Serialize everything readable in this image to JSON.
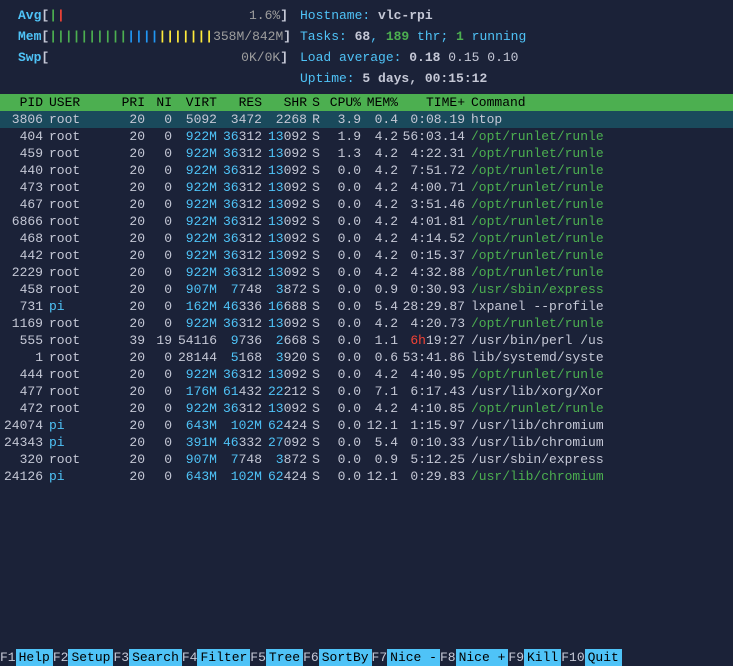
{
  "meters": {
    "avg": {
      "label": "Avg",
      "bars": "||",
      "value": "1.6%"
    },
    "mem": {
      "label": "Mem",
      "bars": "|||||||||||||||||||||",
      "value": "358M/842M"
    },
    "swp": {
      "label": "Swp",
      "bars": "",
      "value": "0K/0K"
    }
  },
  "info": {
    "hostname_label": "Hostname: ",
    "hostname": "vlc-rpi",
    "tasks_label": "Tasks: ",
    "tasks_count": "68",
    "tasks_sep1": ", ",
    "threads": "189",
    "tasks_thr": " thr; ",
    "running": "1",
    "running_label": " running",
    "load_label": "Load average: ",
    "load1": "0.18",
    "load2": "0.15",
    "load3": "0.10",
    "uptime_label": "Uptime: ",
    "uptime": "5 days, 00:15:12"
  },
  "headers": {
    "pid": "PID",
    "user": "USER",
    "pri": "PRI",
    "ni": "NI",
    "virt": "VIRT",
    "res": "RES",
    "shr": "SHR",
    "s": "S",
    "cpu": "CPU%",
    "mem": "MEM%",
    "time": "TIME+",
    "cmd": "Command"
  },
  "processes": [
    {
      "pid": "3806",
      "user": "root",
      "user_cyan": false,
      "pri": "20",
      "ni": "0",
      "virt": "5092",
      "virt_cyan": false,
      "res": "3472",
      "res_hi": false,
      "shr": "2268",
      "shr_hi": false,
      "s": "R",
      "s_green": false,
      "cpu": "3.9",
      "mem": "0.4",
      "time": "0:08.19",
      "time_red": false,
      "cmd": "htop",
      "cmd_green": false,
      "selected": true
    },
    {
      "pid": "404",
      "user": "root",
      "user_cyan": false,
      "pri": "20",
      "ni": "0",
      "virt": "922M",
      "virt_cyan": true,
      "res": "36312",
      "res_hi": true,
      "shr": "13092",
      "shr_hi": true,
      "s": "S",
      "s_green": false,
      "cpu": "1.9",
      "mem": "4.2",
      "time": "56:03.14",
      "time_red": false,
      "cmd": "/opt/runlet/runle",
      "cmd_green": true
    },
    {
      "pid": "459",
      "user": "root",
      "user_cyan": false,
      "pri": "20",
      "ni": "0",
      "virt": "922M",
      "virt_cyan": true,
      "res": "36312",
      "res_hi": true,
      "shr": "13092",
      "shr_hi": true,
      "s": "S",
      "s_green": false,
      "cpu": "1.3",
      "mem": "4.2",
      "time": "4:22.31",
      "time_red": false,
      "cmd": "/opt/runlet/runle",
      "cmd_green": true
    },
    {
      "pid": "440",
      "user": "root",
      "user_cyan": false,
      "pri": "20",
      "ni": "0",
      "virt": "922M",
      "virt_cyan": true,
      "res": "36312",
      "res_hi": true,
      "shr": "13092",
      "shr_hi": true,
      "s": "S",
      "s_green": false,
      "cpu": "0.0",
      "mem": "4.2",
      "time": "7:51.72",
      "time_red": false,
      "cmd": "/opt/runlet/runle",
      "cmd_green": true
    },
    {
      "pid": "473",
      "user": "root",
      "user_cyan": false,
      "pri": "20",
      "ni": "0",
      "virt": "922M",
      "virt_cyan": true,
      "res": "36312",
      "res_hi": true,
      "shr": "13092",
      "shr_hi": true,
      "s": "S",
      "s_green": false,
      "cpu": "0.0",
      "mem": "4.2",
      "time": "4:00.71",
      "time_red": false,
      "cmd": "/opt/runlet/runle",
      "cmd_green": true
    },
    {
      "pid": "467",
      "user": "root",
      "user_cyan": false,
      "pri": "20",
      "ni": "0",
      "virt": "922M",
      "virt_cyan": true,
      "res": "36312",
      "res_hi": true,
      "shr": "13092",
      "shr_hi": true,
      "s": "S",
      "s_green": false,
      "cpu": "0.0",
      "mem": "4.2",
      "time": "3:51.46",
      "time_red": false,
      "cmd": "/opt/runlet/runle",
      "cmd_green": true
    },
    {
      "pid": "6866",
      "user": "root",
      "user_cyan": false,
      "pri": "20",
      "ni": "0",
      "virt": "922M",
      "virt_cyan": true,
      "res": "36312",
      "res_hi": true,
      "shr": "13092",
      "shr_hi": true,
      "s": "S",
      "s_green": false,
      "cpu": "0.0",
      "mem": "4.2",
      "time": "4:01.81",
      "time_red": false,
      "cmd": "/opt/runlet/runle",
      "cmd_green": true
    },
    {
      "pid": "468",
      "user": "root",
      "user_cyan": false,
      "pri": "20",
      "ni": "0",
      "virt": "922M",
      "virt_cyan": true,
      "res": "36312",
      "res_hi": true,
      "shr": "13092",
      "shr_hi": true,
      "s": "S",
      "s_green": false,
      "cpu": "0.0",
      "mem": "4.2",
      "time": "4:14.52",
      "time_red": false,
      "cmd": "/opt/runlet/runle",
      "cmd_green": true
    },
    {
      "pid": "442",
      "user": "root",
      "user_cyan": false,
      "pri": "20",
      "ni": "0",
      "virt": "922M",
      "virt_cyan": true,
      "res": "36312",
      "res_hi": true,
      "shr": "13092",
      "shr_hi": true,
      "s": "S",
      "s_green": false,
      "cpu": "0.0",
      "mem": "4.2",
      "time": "0:15.37",
      "time_red": false,
      "cmd": "/opt/runlet/runle",
      "cmd_green": true
    },
    {
      "pid": "2229",
      "user": "root",
      "user_cyan": false,
      "pri": "20",
      "ni": "0",
      "virt": "922M",
      "virt_cyan": true,
      "res": "36312",
      "res_hi": true,
      "shr": "13092",
      "shr_hi": true,
      "s": "S",
      "s_green": false,
      "cpu": "0.0",
      "mem": "4.2",
      "time": "4:32.88",
      "time_red": false,
      "cmd": "/opt/runlet/runle",
      "cmd_green": true
    },
    {
      "pid": "458",
      "user": "root",
      "user_cyan": false,
      "pri": "20",
      "ni": "0",
      "virt": "907M",
      "virt_cyan": true,
      "res": "7748",
      "res_hi": true,
      "shr": "3872",
      "shr_hi": true,
      "s": "S",
      "s_green": false,
      "cpu": "0.0",
      "mem": "0.9",
      "time": "0:30.93",
      "time_red": false,
      "cmd": "/usr/sbin/express",
      "cmd_green": true
    },
    {
      "pid": "731",
      "user": "pi",
      "user_cyan": true,
      "pri": "20",
      "ni": "0",
      "virt": "162M",
      "virt_cyan": true,
      "res": "46336",
      "res_hi": true,
      "shr": "16688",
      "shr_hi": true,
      "s": "S",
      "s_green": false,
      "cpu": "0.0",
      "mem": "5.4",
      "time": "28:29.87",
      "time_red": false,
      "cmd": "lxpanel --profile",
      "cmd_green": false
    },
    {
      "pid": "1169",
      "user": "root",
      "user_cyan": false,
      "pri": "20",
      "ni": "0",
      "virt": "922M",
      "virt_cyan": true,
      "res": "36312",
      "res_hi": true,
      "shr": "13092",
      "shr_hi": true,
      "s": "S",
      "s_green": false,
      "cpu": "0.0",
      "mem": "4.2",
      "time": "4:20.73",
      "time_red": false,
      "cmd": "/opt/runlet/runle",
      "cmd_green": true
    },
    {
      "pid": "555",
      "user": "root",
      "user_cyan": false,
      "pri": "39",
      "ni": "19",
      "virt": "54116",
      "virt_cyan": false,
      "res": "9736",
      "res_hi": true,
      "shr": "2668",
      "shr_hi": true,
      "s": "S",
      "s_green": false,
      "cpu": "0.0",
      "mem": "1.1",
      "time": "6h19:27",
      "time_red": true,
      "cmd": "/usr/bin/perl /us",
      "cmd_green": false
    },
    {
      "pid": "1",
      "user": "root",
      "user_cyan": false,
      "pri": "20",
      "ni": "0",
      "virt": "28144",
      "virt_cyan": false,
      "res": "5168",
      "res_hi": true,
      "shr": "3920",
      "shr_hi": true,
      "s": "S",
      "s_green": false,
      "cpu": "0.0",
      "mem": "0.6",
      "time": "53:41.86",
      "time_red": false,
      "cmd": "lib/systemd/syste",
      "cmd_green": false
    },
    {
      "pid": "444",
      "user": "root",
      "user_cyan": false,
      "pri": "20",
      "ni": "0",
      "virt": "922M",
      "virt_cyan": true,
      "res": "36312",
      "res_hi": true,
      "shr": "13092",
      "shr_hi": true,
      "s": "S",
      "s_green": false,
      "cpu": "0.0",
      "mem": "4.2",
      "time": "4:40.95",
      "time_red": false,
      "cmd": "/opt/runlet/runle",
      "cmd_green": true
    },
    {
      "pid": "477",
      "user": "root",
      "user_cyan": false,
      "pri": "20",
      "ni": "0",
      "virt": "176M",
      "virt_cyan": true,
      "res": "61432",
      "res_hi": true,
      "shr": "22212",
      "shr_hi": true,
      "s": "S",
      "s_green": false,
      "cpu": "0.0",
      "mem": "7.1",
      "time": "6:17.43",
      "time_red": false,
      "cmd": "/usr/lib/xorg/Xor",
      "cmd_green": false
    },
    {
      "pid": "472",
      "user": "root",
      "user_cyan": false,
      "pri": "20",
      "ni": "0",
      "virt": "922M",
      "virt_cyan": true,
      "res": "36312",
      "res_hi": true,
      "shr": "13092",
      "shr_hi": true,
      "s": "S",
      "s_green": false,
      "cpu": "0.0",
      "mem": "4.2",
      "time": "4:10.85",
      "time_red": false,
      "cmd": "/opt/runlet/runle",
      "cmd_green": true
    },
    {
      "pid": "24074",
      "user": "pi",
      "user_cyan": true,
      "pri": "20",
      "ni": "0",
      "virt": "643M",
      "virt_cyan": true,
      "res": "102M",
      "res_hi": true,
      "shr": "62424",
      "shr_hi": true,
      "s": "S",
      "s_green": false,
      "cpu": "0.0",
      "mem": "12.1",
      "time": "1:15.97",
      "time_red": false,
      "cmd": "/usr/lib/chromium",
      "cmd_green": false
    },
    {
      "pid": "24343",
      "user": "pi",
      "user_cyan": true,
      "pri": "20",
      "ni": "0",
      "virt": "391M",
      "virt_cyan": true,
      "res": "46332",
      "res_hi": true,
      "shr": "27092",
      "shr_hi": true,
      "s": "S",
      "s_green": false,
      "cpu": "0.0",
      "mem": "5.4",
      "time": "0:10.33",
      "time_red": false,
      "cmd": "/usr/lib/chromium",
      "cmd_green": false
    },
    {
      "pid": "320",
      "user": "root",
      "user_cyan": false,
      "pri": "20",
      "ni": "0",
      "virt": "907M",
      "virt_cyan": true,
      "res": "7748",
      "res_hi": true,
      "shr": "3872",
      "shr_hi": true,
      "s": "S",
      "s_green": false,
      "cpu": "0.0",
      "mem": "0.9",
      "time": "5:12.25",
      "time_red": false,
      "cmd": "/usr/sbin/express",
      "cmd_green": false
    },
    {
      "pid": "24126",
      "user": "pi",
      "user_cyan": true,
      "pri": "20",
      "ni": "0",
      "virt": "643M",
      "virt_cyan": true,
      "res": "102M",
      "res_hi": true,
      "shr": "62424",
      "shr_hi": true,
      "s": "S",
      "s_green": false,
      "cpu": "0.0",
      "mem": "12.1",
      "time": "0:29.83",
      "time_red": false,
      "cmd": "/usr/lib/chromium",
      "cmd_green": true
    }
  ],
  "footer": [
    {
      "key": "F1",
      "label": "Help  "
    },
    {
      "key": "F2",
      "label": "Setup "
    },
    {
      "key": "F3",
      "label": "Search"
    },
    {
      "key": "F4",
      "label": "Filter"
    },
    {
      "key": "F5",
      "label": "Tree  "
    },
    {
      "key": "F6",
      "label": "SortBy"
    },
    {
      "key": "F7",
      "label": "Nice -"
    },
    {
      "key": "F8",
      "label": "Nice +"
    },
    {
      "key": "F9",
      "label": "Kill  "
    },
    {
      "key": "F10",
      "label": "Quit  "
    }
  ]
}
